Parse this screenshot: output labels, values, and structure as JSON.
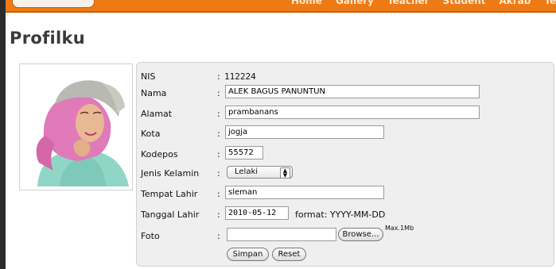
{
  "nav": {
    "items": [
      "Home",
      "Gallery",
      "Teacher",
      "Student",
      "Akrab",
      "Teche"
    ]
  },
  "page": {
    "title": "Profilku"
  },
  "form": {
    "nis": {
      "label": "NIS",
      "colon": ":",
      "value": "112224"
    },
    "nama": {
      "label": "Nama",
      "colon": ":",
      "value": "ALEK BAGUS PANUNTUN"
    },
    "alamat": {
      "label": "Alamat",
      "colon": ":",
      "value": "prambanans"
    },
    "kota": {
      "label": "Kota",
      "colon": ":",
      "value": "jogja"
    },
    "kodepos": {
      "label": "Kodepos",
      "colon": ":",
      "value": "55572"
    },
    "jenis_kelamin": {
      "label": "Jenis Kelamin",
      "colon": ":",
      "value": "Lelaki"
    },
    "tempat_lahir": {
      "label": "Tempat Lahir",
      "colon": ":",
      "value": "sleman"
    },
    "tanggal_lahir": {
      "label": "Tanggal Lahir",
      "colon": ":",
      "value": "2010-05-12",
      "format_note": "format: YYYY-MM-DD"
    },
    "foto": {
      "label": "Foto",
      "colon": ":",
      "browse_label": "Browse...",
      "max_note": "Max.1Mb"
    },
    "buttons": {
      "save": "Simpan",
      "reset": "Reset"
    }
  },
  "colors": {
    "nav_bg": "#ee7a16",
    "panel_bg": "#efefef",
    "title": "#3a3a3a"
  }
}
